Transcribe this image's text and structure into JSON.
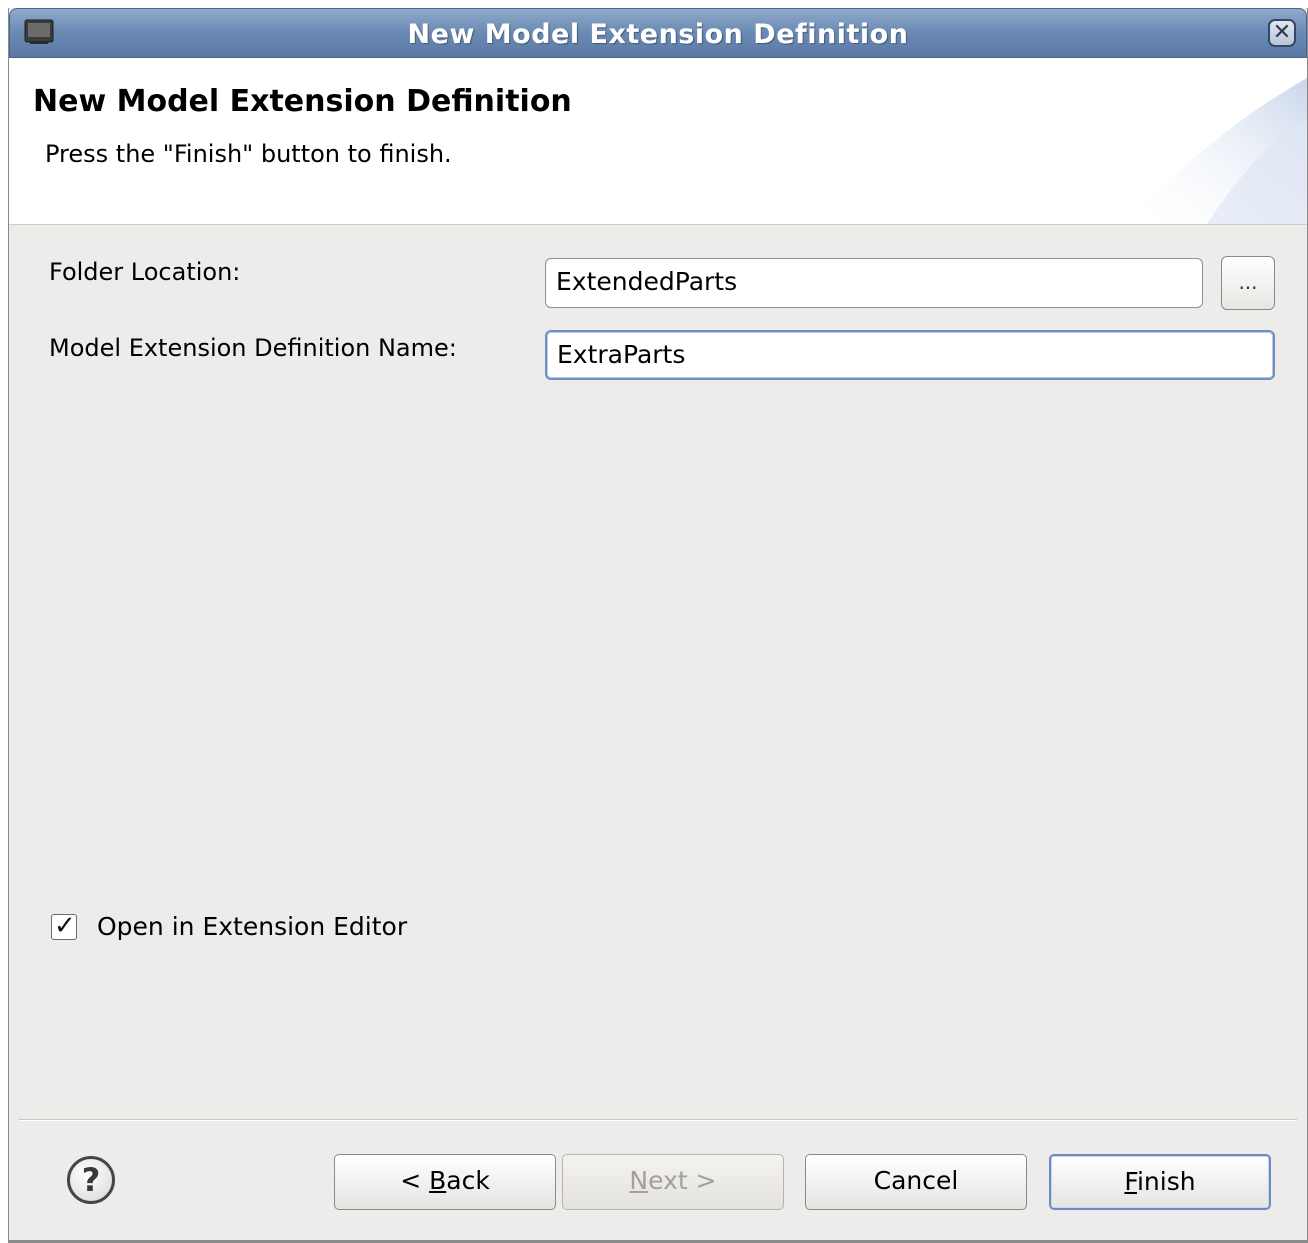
{
  "window": {
    "title": "New Model Extension Definition",
    "icons": {
      "app": "window-icon",
      "close": "close-icon"
    }
  },
  "header": {
    "heading": "New Model Extension Definition",
    "description": "Press the \"Finish\" button to finish."
  },
  "form": {
    "folder_location": {
      "label": "Folder Location:",
      "value": "ExtendedParts",
      "browse_label": "..."
    },
    "definition_name": {
      "label": "Model Extension Definition Name:",
      "value": "ExtraParts"
    },
    "open_in_editor": {
      "label": "Open in Extension Editor",
      "checked": true
    }
  },
  "buttons": {
    "help": "?",
    "back": {
      "prefix": "< ",
      "mnemonic": "B",
      "rest": "ack"
    },
    "next": {
      "mnemonic": "N",
      "rest": "ext >"
    },
    "cancel": "Cancel",
    "finish": {
      "mnemonic": "F",
      "rest": "inish"
    }
  },
  "colors": {
    "titlebar": "#6a8ab4",
    "dialog_bg": "#edeceb",
    "focus_border": "#6f8fbf"
  }
}
